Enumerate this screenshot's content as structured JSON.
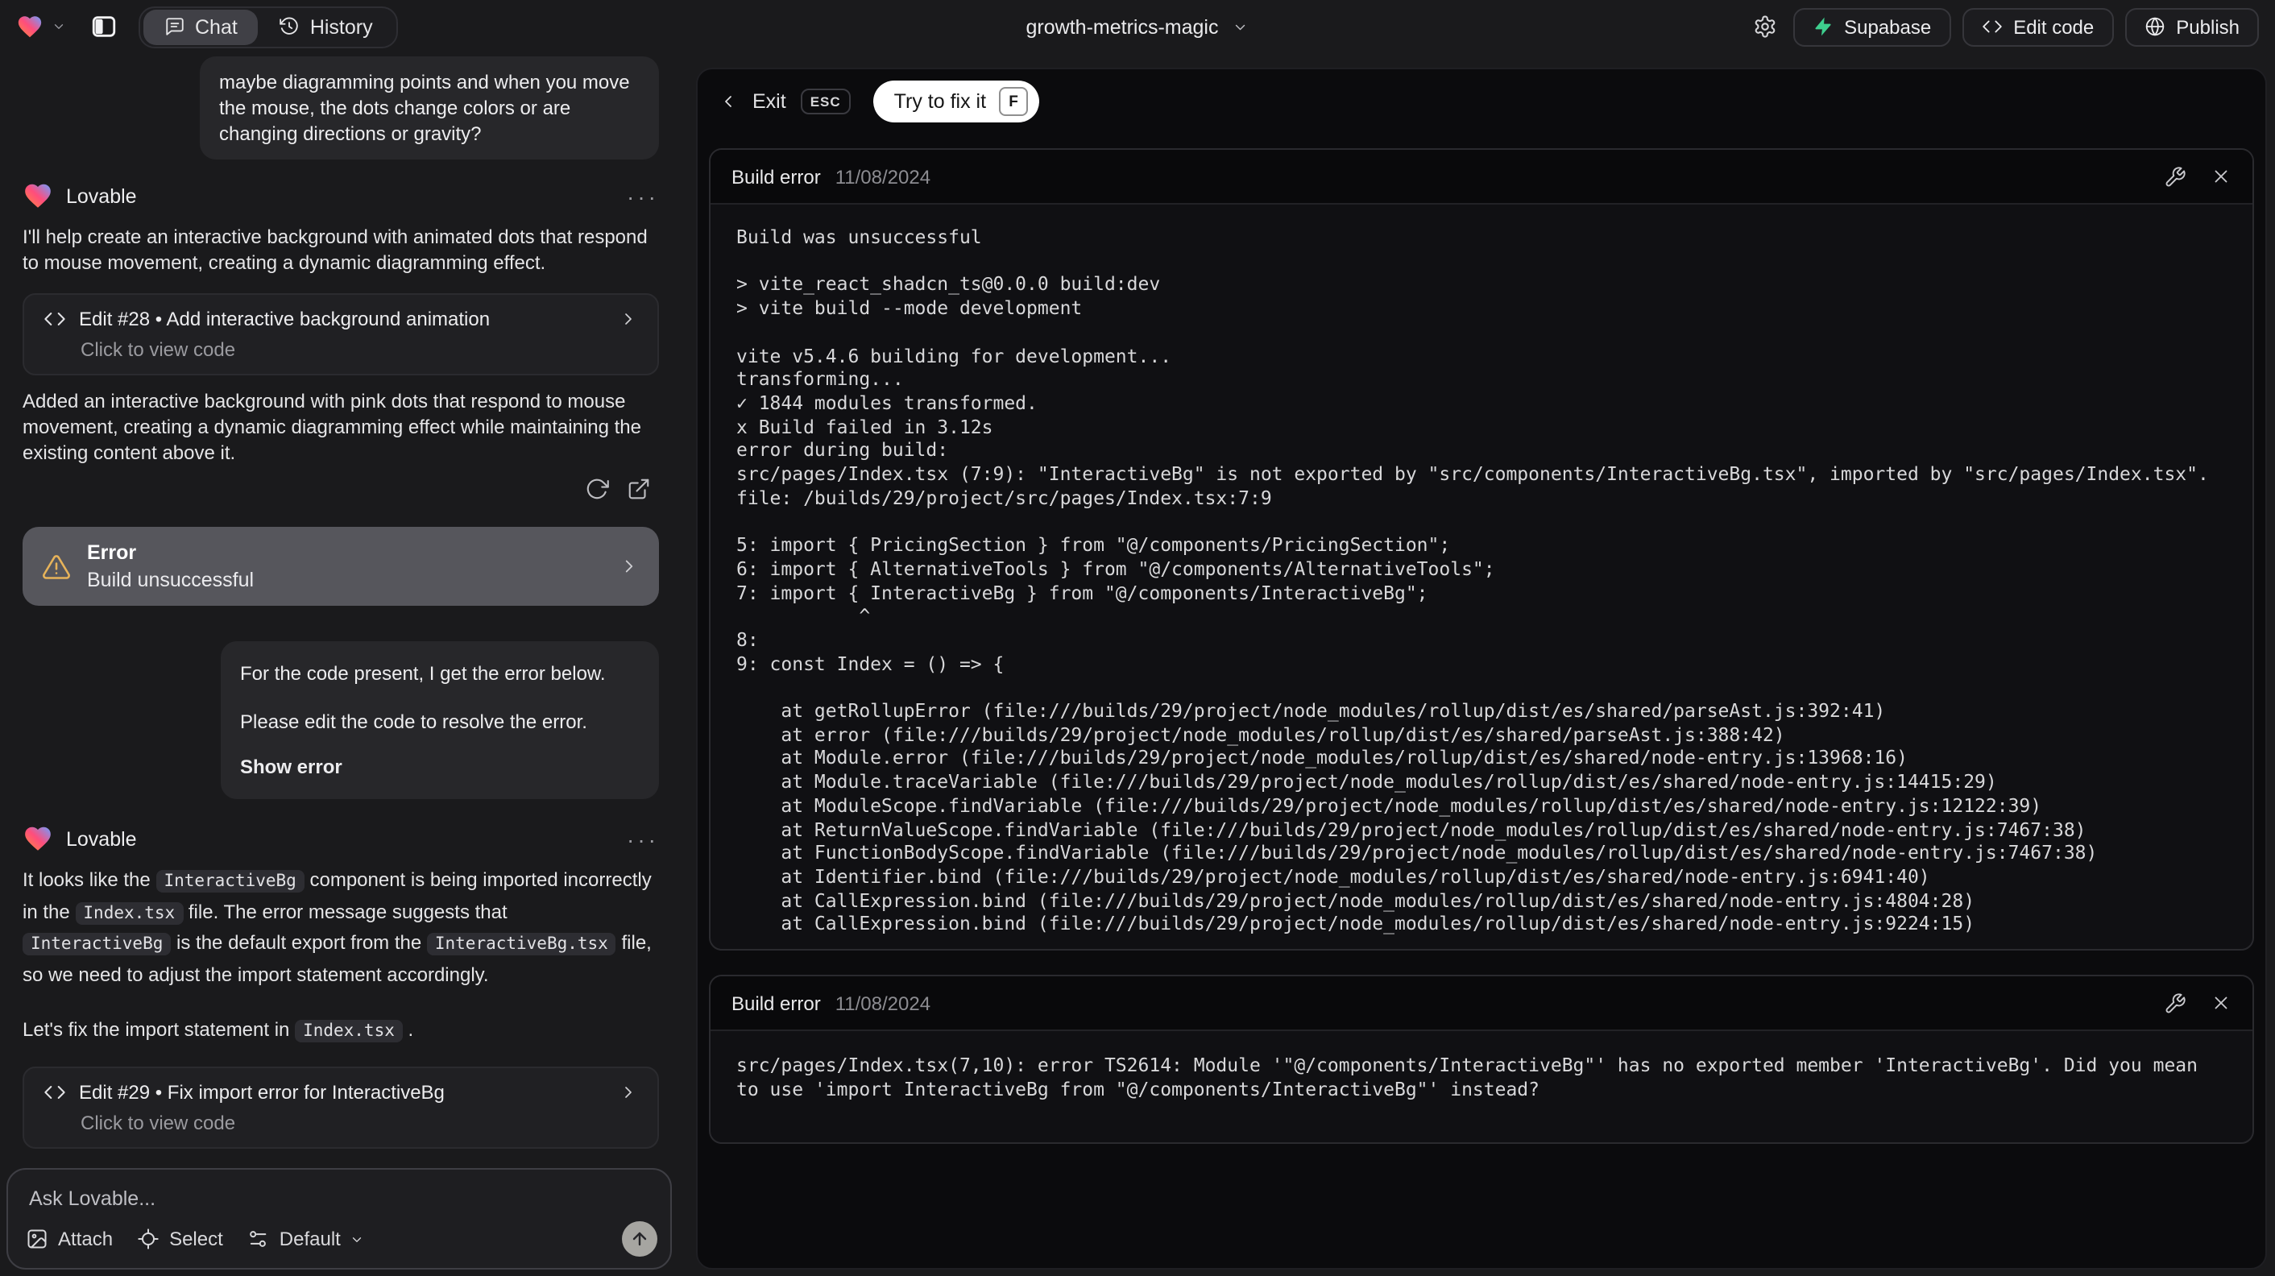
{
  "topbar": {
    "project_name": "growth-metrics-magic",
    "tabs": {
      "chat": "Chat",
      "history": "History"
    },
    "buttons": {
      "supabase": "Supabase",
      "edit_code": "Edit code",
      "publish": "Publish"
    }
  },
  "icons": {
    "logo": "gradient-heart",
    "sidebar": "panel-left",
    "chat": "speech-bubble",
    "history": "clock-rewind",
    "gear": "settings-gear",
    "supabase": "green-bolt",
    "edit_code": "angle-brackets",
    "publish": "globe",
    "refresh": "rotate-arrow",
    "open_preview": "external-link",
    "warning": "amber-triangle",
    "wrench": "wrench",
    "close": "x",
    "attach": "image",
    "select": "crosshair",
    "model": "sliders",
    "send": "arrow-up"
  },
  "chat": {
    "assistant_name": "Lovable",
    "more_label": "···",
    "user_message_1": "maybe diagramming points and when you move the mouse, the dots change colors or are changing directions or gravity?",
    "assistant_intro": "I'll help create an interactive background with animated dots that respond to mouse movement, creating a dynamic diagramming effect.",
    "edit_card_28": {
      "title": "Edit #28 • Add interactive background animation",
      "subtitle": "Click to view code"
    },
    "assistant_followup": "Added an interactive background with pink dots that respond to mouse movement, creating a dynamic diagramming effect while maintaining the existing content above it.",
    "error_banner": {
      "title": "Error",
      "subtitle": "Build unsuccessful"
    },
    "user_message_2": {
      "line1": "For the code present, I get the error below.",
      "line2": "Please edit the code to resolve the error.",
      "link": "Show error"
    },
    "fix_message": [
      {
        "text": "It looks like the "
      },
      {
        "code": "InteractiveBg"
      },
      {
        "text": " component is being imported incorrectly in the "
      },
      {
        "code": "Index.tsx"
      },
      {
        "text": " file. The error message suggests that "
      },
      {
        "code": "InteractiveBg"
      },
      {
        "text": " is the default export from the "
      },
      {
        "code": "InteractiveBg.tsx"
      },
      {
        "text": " file, so we need to adjust the import statement accordingly."
      }
    ],
    "fix_message_2": [
      {
        "text": "Let's fix the import statement in "
      },
      {
        "code": "Index.tsx"
      },
      {
        "text": " ."
      }
    ],
    "edit_card_29": {
      "title": "Edit #29 • Fix import error for InteractiveBg",
      "subtitle": "Click to view code"
    },
    "input": {
      "placeholder": "Ask Lovable...",
      "attach": "Attach",
      "select": "Select",
      "model": "Default"
    }
  },
  "preview": {
    "exit_label": "Exit",
    "esc_label": "ESC",
    "fix_button": "Try to fix it",
    "fix_key": "F",
    "cards": [
      {
        "title": "Build error",
        "date": "11/08/2024",
        "log": "Build was unsuccessful\n\n> vite_react_shadcn_ts@0.0.0 build:dev\n> vite build --mode development\n\nvite v5.4.6 building for development...\ntransforming...\n✓ 1844 modules transformed.\nx Build failed in 3.12s\nerror during build:\nsrc/pages/Index.tsx (7:9): \"InteractiveBg\" is not exported by \"src/components/InteractiveBg.tsx\", imported by \"src/pages/Index.tsx\".\nfile: /builds/29/project/src/pages/Index.tsx:7:9\n\n5: import { PricingSection } from \"@/components/PricingSection\";\n6: import { AlternativeTools } from \"@/components/AlternativeTools\";\n7: import { InteractiveBg } from \"@/components/InteractiveBg\";\n           ^\n8: \n9: const Index = () => {\n\n    at getRollupError (file:///builds/29/project/node_modules/rollup/dist/es/shared/parseAst.js:392:41)\n    at error (file:///builds/29/project/node_modules/rollup/dist/es/shared/parseAst.js:388:42)\n    at Module.error (file:///builds/29/project/node_modules/rollup/dist/es/shared/node-entry.js:13968:16)\n    at Module.traceVariable (file:///builds/29/project/node_modules/rollup/dist/es/shared/node-entry.js:14415:29)\n    at ModuleScope.findVariable (file:///builds/29/project/node_modules/rollup/dist/es/shared/node-entry.js:12122:39)\n    at ReturnValueScope.findVariable (file:///builds/29/project/node_modules/rollup/dist/es/shared/node-entry.js:7467:38)\n    at FunctionBodyScope.findVariable (file:///builds/29/project/node_modules/rollup/dist/es/shared/node-entry.js:7467:38)\n    at Identifier.bind (file:///builds/29/project/node_modules/rollup/dist/es/shared/node-entry.js:6941:40)\n    at CallExpression.bind (file:///builds/29/project/node_modules/rollup/dist/es/shared/node-entry.js:4804:28)\n    at CallExpression.bind (file:///builds/29/project/node_modules/rollup/dist/es/shared/node-entry.js:9224:15)"
      },
      {
        "title": "Build error",
        "date": "11/08/2024",
        "log": "src/pages/Index.tsx(7,10): error TS2614: Module '\"@/components/InteractiveBg\"' has no exported member 'InteractiveBg'. Did you mean to use 'import InteractiveBg from \"@/components/InteractiveBg\"' instead?"
      }
    ]
  },
  "colors": {
    "accent_warning": "#e7b35a",
    "supabase_green": "#3ecf8e",
    "panel_bg": "#0b0b0d",
    "app_bg": "#1a1a1c"
  }
}
